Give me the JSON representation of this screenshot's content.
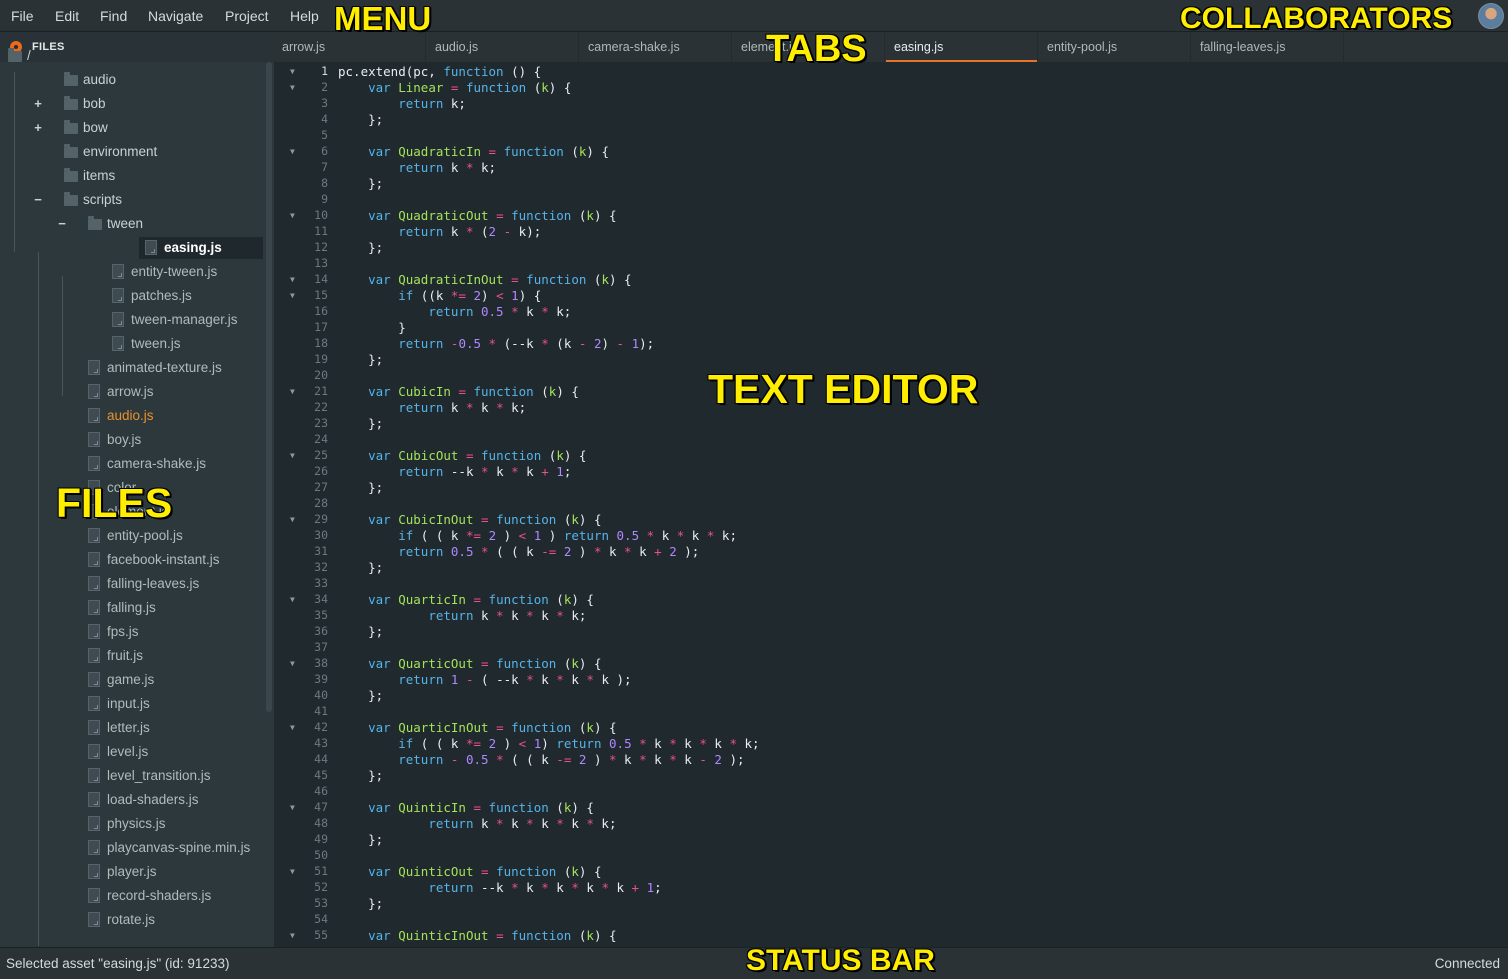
{
  "menu": {
    "items": [
      "File",
      "Edit",
      "Find",
      "Navigate",
      "Project",
      "Help"
    ]
  },
  "sidebar": {
    "title": "FILES",
    "tree": [
      {
        "label": "/",
        "type": "folder",
        "state": "root"
      },
      {
        "label": "audio",
        "type": "folder"
      },
      {
        "label": "bob",
        "type": "folder",
        "toggle": "+"
      },
      {
        "label": "bow",
        "type": "folder",
        "toggle": "+"
      },
      {
        "label": "environment",
        "type": "folder"
      },
      {
        "label": "items",
        "type": "folder"
      },
      {
        "label": "scripts",
        "type": "folder",
        "toggle": "−"
      },
      {
        "label": "tween",
        "type": "folder",
        "toggle": "−"
      },
      {
        "label": "easing.js",
        "type": "file",
        "selected": true
      },
      {
        "label": "entity-tween.js",
        "type": "file"
      },
      {
        "label": "patches.js",
        "type": "file"
      },
      {
        "label": "tween-manager.js",
        "type": "file"
      },
      {
        "label": "tween.js",
        "type": "file"
      },
      {
        "label": "animated-texture.js",
        "type": "file"
      },
      {
        "label": "arrow.js",
        "type": "file"
      },
      {
        "label": "audio.js",
        "type": "file",
        "highlight": true
      },
      {
        "label": "boy.js",
        "type": "file"
      },
      {
        "label": "camera-shake.js",
        "type": "file"
      },
      {
        "label": "color",
        "type": "file"
      },
      {
        "label": "element.js",
        "type": "file"
      },
      {
        "label": "entity-pool.js",
        "type": "file"
      },
      {
        "label": "facebook-instant.js",
        "type": "file"
      },
      {
        "label": "falling-leaves.js",
        "type": "file"
      },
      {
        "label": "falling.js",
        "type": "file"
      },
      {
        "label": "fps.js",
        "type": "file"
      },
      {
        "label": "fruit.js",
        "type": "file"
      },
      {
        "label": "game.js",
        "type": "file"
      },
      {
        "label": "input.js",
        "type": "file"
      },
      {
        "label": "letter.js",
        "type": "file"
      },
      {
        "label": "level.js",
        "type": "file"
      },
      {
        "label": "level_transition.js",
        "type": "file"
      },
      {
        "label": "load-shaders.js",
        "type": "file"
      },
      {
        "label": "physics.js",
        "type": "file"
      },
      {
        "label": "playcanvas-spine.min.js",
        "type": "file"
      },
      {
        "label": "player.js",
        "type": "file"
      },
      {
        "label": "record-shaders.js",
        "type": "file"
      },
      {
        "label": "rotate.js",
        "type": "file"
      }
    ]
  },
  "tabs": [
    {
      "label": "arrow.js"
    },
    {
      "label": "audio.js"
    },
    {
      "label": "camera-shake.js"
    },
    {
      "label": "element.js"
    },
    {
      "label": "easing.js",
      "active": true
    },
    {
      "label": "entity-pool.js"
    },
    {
      "label": "falling-leaves.js"
    }
  ],
  "editor": {
    "current_line": 1,
    "fold_lines": [
      1,
      2,
      6,
      10,
      14,
      15,
      21,
      25,
      29,
      34,
      38,
      42,
      47,
      51,
      55
    ],
    "lines": [
      "pc.extend(pc, function () {",
      "    var Linear = function (k) {",
      "        return k;",
      "    };",
      "",
      "    var QuadraticIn = function (k) {",
      "        return k * k;",
      "    };",
      "",
      "    var QuadraticOut = function (k) {",
      "        return k * (2 - k);",
      "    };",
      "",
      "    var QuadraticInOut = function (k) {",
      "        if ((k *= 2) < 1) {",
      "            return 0.5 * k * k;",
      "        }",
      "        return -0.5 * (--k * (k - 2) - 1);",
      "    };",
      "",
      "    var CubicIn = function (k) {",
      "        return k * k * k;",
      "    };",
      "",
      "    var CubicOut = function (k) {",
      "        return --k * k * k + 1;",
      "    };",
      "",
      "    var CubicInOut = function (k) {",
      "        if ( ( k *= 2 ) < 1 ) return 0.5 * k * k * k;",
      "        return 0.5 * ( ( k -= 2 ) * k * k + 2 );",
      "    };",
      "",
      "    var QuarticIn = function (k) {",
      "            return k * k * k * k;",
      "    };",
      "",
      "    var QuarticOut = function (k) {",
      "        return 1 - ( --k * k * k * k );",
      "    };",
      "",
      "    var QuarticInOut = function (k) {",
      "        if ( ( k *= 2 ) < 1) return 0.5 * k * k * k * k;",
      "        return - 0.5 * ( ( k -= 2 ) * k * k * k - 2 );",
      "    };",
      "",
      "    var QuinticIn = function (k) {",
      "            return k * k * k * k * k;",
      "    };",
      "",
      "    var QuinticOut = function (k) {",
      "            return --k * k * k * k * k + 1;",
      "    };",
      "",
      "    var QuinticInOut = function (k) {"
    ]
  },
  "status": {
    "left": "Selected asset \"easing.js\" (id: 91233)",
    "right": "Connected"
  },
  "annotations": {
    "menu": "MENU",
    "tabs": "TABS",
    "collaborators": "COLLABORATORS",
    "text_editor": "TEXT EDITOR",
    "files": "FILES",
    "status_bar": "STATUS BAR"
  },
  "colors": {
    "accent": "#e8722a",
    "keyword": "#57b3e9",
    "function_name": "#a3e35a",
    "operator": "#f0508a",
    "number": "#b286ff",
    "highlight_file": "#e8922a",
    "annotation": "#ffee00"
  }
}
